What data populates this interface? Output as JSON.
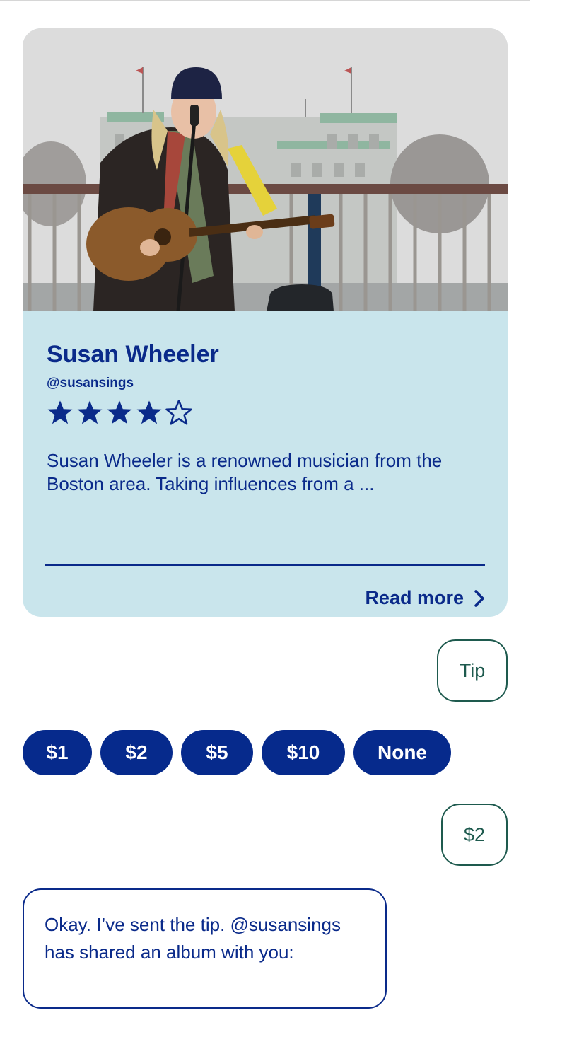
{
  "profile": {
    "name": "Susan Wheeler",
    "handle": "@susansings",
    "rating": 4,
    "rating_max": 5,
    "bio": "Susan Wheeler is a renowned musician from the Boston area. Taking influences from a ...",
    "read_more_label": "Read more",
    "photo_subject": "street-musician-with-guitar"
  },
  "chat": {
    "user_message_1": "Tip",
    "tip_options": [
      "$1",
      "$2",
      "$5",
      "$10",
      "None"
    ],
    "user_message_2": "$2",
    "bot_message": "Okay. I’ve sent the tip. @susansings has shared an album with you:"
  },
  "colors": {
    "primary": "#0a2a8a",
    "card_background": "#c9e5ec",
    "user_bubble_border": "#1e5a4e",
    "chip_background": "#062a8c"
  },
  "icons": {
    "star_filled": "star-filled-icon",
    "star_empty": "star-outline-icon",
    "chevron": "chevron-right-icon"
  }
}
